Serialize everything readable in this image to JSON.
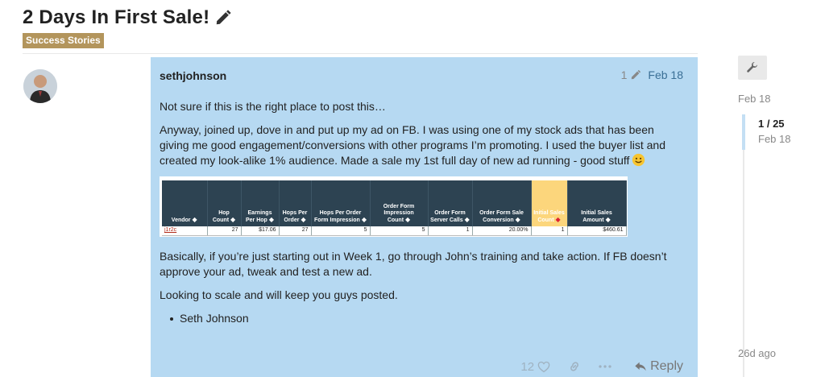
{
  "topic": {
    "title": "2 Days In First Sale!",
    "category": "Success Stories"
  },
  "post": {
    "username": "sethjohnson",
    "edit_count": "1",
    "date": "Feb 18",
    "paragraphs": [
      "Not sure if this is the right place to post this…",
      "Anyway, joined up, dove in and put up my ad on FB. I was using one of my stock ads that has been giving me good engagement/conversions with other programs I’m promoting. I used the buyer list and created my look-alike 1% audience. Made a sale my 1st full day of new ad running - good stuff",
      "Basically, if you’re just starting out in Week 1, go through John’s training and take action. If FB doesn’t approve your ad, tweak and test a new ad.",
      "Looking to scale and will keep you guys posted."
    ],
    "list_item": "Seth Johnson",
    "like_count": "12",
    "reply_label": "Reply"
  },
  "stats_table": {
    "headers": [
      "Vendor",
      "Hop Count",
      "Earnings Per Hop",
      "Hops Per Order",
      "Hops Per Order Form Impression",
      "Order Form Impression Count",
      "Order Form Server Calls",
      "Order Form Sale Conversion",
      "Initial Sales Count",
      "Initial Sales Amount"
    ],
    "row": [
      "j1r2c",
      "27",
      "$17.06",
      "27",
      "5",
      "5",
      "1",
      "20.00%",
      "1",
      "$460.61"
    ]
  },
  "timeline": {
    "start_date": "Feb 18",
    "position": "1 / 25",
    "position_date": "Feb 18",
    "end_label": "26d ago"
  },
  "colors": {
    "post_highlight": "#b6d9f2",
    "category": "#b3955c",
    "table_header": "#2d4352",
    "table_header_highlight": "#fcd67c"
  }
}
